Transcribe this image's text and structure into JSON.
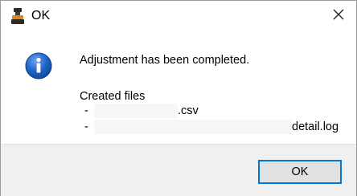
{
  "window": {
    "title": "OK",
    "app_icon": "stamp-icon",
    "close_icon": "close-icon"
  },
  "content": {
    "icon": "info-icon",
    "message": "Adjustment has been completed.",
    "files_label": "Created files",
    "files": [
      {
        "bullet": "-",
        "suffix": ".csv"
      },
      {
        "bullet": "-",
        "suffix": "detail.log"
      }
    ]
  },
  "footer": {
    "ok_label": "OK"
  },
  "colors": {
    "accent": "#0078d7",
    "info_blue": "#1b63c6",
    "footer_bg": "#f0f0f0"
  }
}
